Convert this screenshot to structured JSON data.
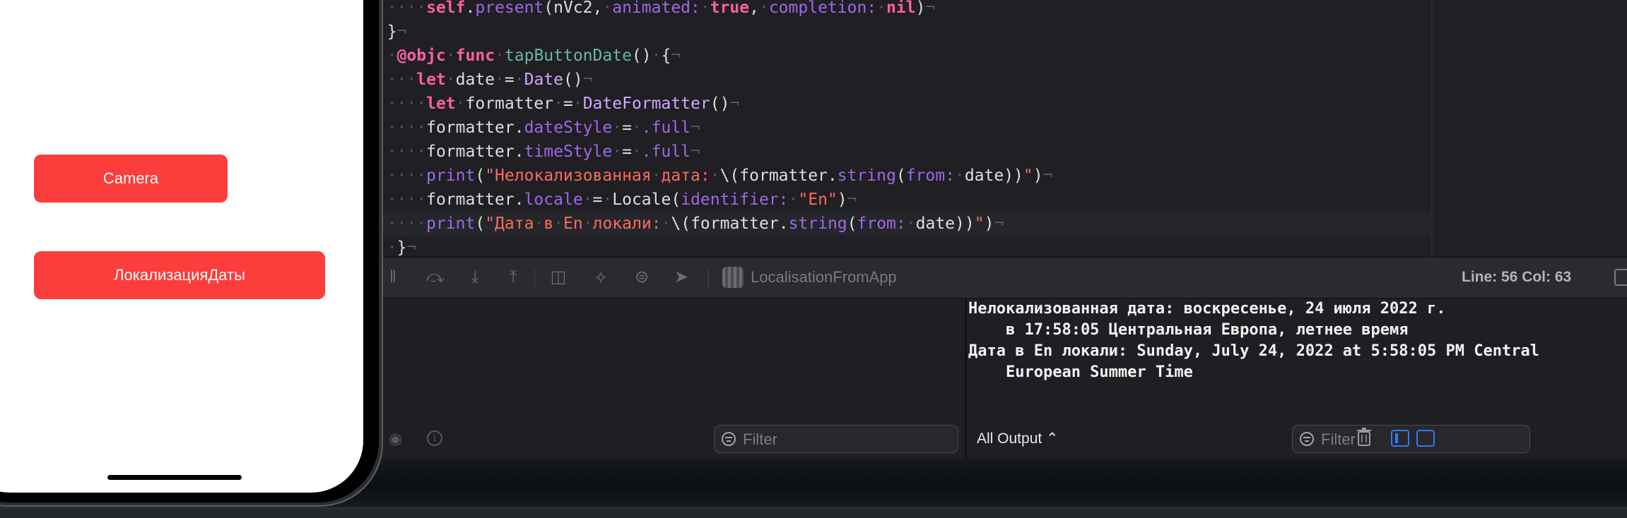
{
  "simulator": {
    "buttons": {
      "camera": "Camera",
      "date_localization": "ЛокализацияДаты"
    },
    "button_color": "#fb3d3b"
  },
  "editor": {
    "lines": [
      {
        "indent": "······",
        "tokens": [
          {
            "t": "self",
            "c": "kw"
          },
          {
            "t": ".",
            "c": ""
          },
          {
            "t": "present",
            "c": "mem"
          },
          {
            "t": "(nVc2,",
            "c": ""
          },
          {
            "t": "·",
            "c": "inv"
          },
          {
            "t": "animated:",
            "c": "ty"
          },
          {
            "t": "·",
            "c": "inv"
          },
          {
            "t": "true",
            "c": "kw"
          },
          {
            "t": ",",
            "c": ""
          },
          {
            "t": "·",
            "c": "inv"
          },
          {
            "t": "completion:",
            "c": "ty"
          },
          {
            "t": "·",
            "c": "inv"
          },
          {
            "t": "nil",
            "c": "kw"
          },
          {
            "t": ")",
            "c": ""
          },
          {
            "t": "¬",
            "c": "inv"
          }
        ]
      },
      {
        "indent": "··",
        "tokens": [
          {
            "t": "}",
            "c": ""
          },
          {
            "t": "¬",
            "c": "inv"
          }
        ]
      },
      {
        "indent": "···",
        "tokens": [
          {
            "t": "@objc",
            "c": "kw"
          },
          {
            "t": "·",
            "c": "inv"
          },
          {
            "t": "func",
            "c": "kw"
          },
          {
            "t": "·",
            "c": "inv"
          },
          {
            "t": "tapButtonDate",
            "c": "fn"
          },
          {
            "t": "()",
            "c": ""
          },
          {
            "t": "·",
            "c": "inv"
          },
          {
            "t": "{",
            "c": ""
          },
          {
            "t": "¬",
            "c": "inv"
          }
        ]
      },
      {
        "indent": "·····",
        "tokens": [
          {
            "t": "let",
            "c": "kw"
          },
          {
            "t": "·",
            "c": "inv"
          },
          {
            "t": "date",
            "c": ""
          },
          {
            "t": "·",
            "c": "inv"
          },
          {
            "t": "=",
            "c": ""
          },
          {
            "t": "·",
            "c": "inv"
          },
          {
            "t": "Date",
            "c": "ty2"
          },
          {
            "t": "()",
            "c": ""
          },
          {
            "t": "¬",
            "c": "inv"
          }
        ]
      },
      {
        "indent": "······",
        "tokens": [
          {
            "t": "let",
            "c": "kw"
          },
          {
            "t": "·",
            "c": "inv"
          },
          {
            "t": "formatter",
            "c": ""
          },
          {
            "t": "·",
            "c": "inv"
          },
          {
            "t": "=",
            "c": ""
          },
          {
            "t": "·",
            "c": "inv"
          },
          {
            "t": "DateFormatter",
            "c": "ty2"
          },
          {
            "t": "()",
            "c": ""
          },
          {
            "t": "¬",
            "c": "inv"
          }
        ]
      },
      {
        "indent": "······",
        "tokens": [
          {
            "t": "formatter.",
            "c": ""
          },
          {
            "t": "dateStyle",
            "c": "mem"
          },
          {
            "t": "·",
            "c": "inv"
          },
          {
            "t": "=",
            "c": ""
          },
          {
            "t": "·",
            "c": "inv"
          },
          {
            "t": ".full",
            "c": "mem"
          },
          {
            "t": "¬",
            "c": "inv"
          }
        ]
      },
      {
        "indent": "······",
        "tokens": [
          {
            "t": "formatter.",
            "c": ""
          },
          {
            "t": "timeStyle",
            "c": "mem"
          },
          {
            "t": "·",
            "c": "inv"
          },
          {
            "t": "=",
            "c": ""
          },
          {
            "t": "·",
            "c": "inv"
          },
          {
            "t": ".full",
            "c": "mem"
          },
          {
            "t": "¬",
            "c": "inv"
          }
        ]
      },
      {
        "indent": "······",
        "tokens": [
          {
            "t": "print",
            "c": "mem"
          },
          {
            "t": "(",
            "c": ""
          },
          {
            "t": "\"Нелокализованная",
            "c": "str"
          },
          {
            "t": "·",
            "c": "inv"
          },
          {
            "t": "дата:",
            "c": "str"
          },
          {
            "t": "·",
            "c": "inv"
          },
          {
            "t": "\\(formatter.",
            "c": ""
          },
          {
            "t": "string",
            "c": "mem"
          },
          {
            "t": "(",
            "c": ""
          },
          {
            "t": "from:",
            "c": "ty"
          },
          {
            "t": "·",
            "c": "inv"
          },
          {
            "t": "date))",
            "c": ""
          },
          {
            "t": "\"",
            "c": "str"
          },
          {
            "t": ")",
            "c": ""
          },
          {
            "t": "¬",
            "c": "inv"
          }
        ]
      },
      {
        "indent": "······",
        "tokens": [
          {
            "t": "formatter.",
            "c": ""
          },
          {
            "t": "locale",
            "c": "mem"
          },
          {
            "t": "·",
            "c": "inv"
          },
          {
            "t": "=",
            "c": ""
          },
          {
            "t": "·",
            "c": "inv"
          },
          {
            "t": "Locale",
            "c": ""
          },
          {
            "t": "(",
            "c": ""
          },
          {
            "t": "identifier:",
            "c": "ty"
          },
          {
            "t": "·",
            "c": "inv"
          },
          {
            "t": "\"En\"",
            "c": "str"
          },
          {
            "t": ")",
            "c": ""
          },
          {
            "t": "¬",
            "c": "inv"
          }
        ]
      },
      {
        "indent": "······",
        "current": true,
        "tokens": [
          {
            "t": "print",
            "c": "mem"
          },
          {
            "t": "(",
            "c": ""
          },
          {
            "t": "\"Дата",
            "c": "str"
          },
          {
            "t": "·",
            "c": "inv"
          },
          {
            "t": "в",
            "c": "str"
          },
          {
            "t": "·",
            "c": "inv"
          },
          {
            "t": "En",
            "c": "str"
          },
          {
            "t": "·",
            "c": "inv"
          },
          {
            "t": "локали:",
            "c": "str"
          },
          {
            "t": "·",
            "c": "inv"
          },
          {
            "t": "\\(formatter.",
            "c": ""
          },
          {
            "t": "string",
            "c": "mem"
          },
          {
            "t": "(",
            "c": ""
          },
          {
            "t": "from:",
            "c": "ty"
          },
          {
            "t": "·",
            "c": "inv"
          },
          {
            "t": "date))",
            "c": ""
          },
          {
            "t": "\"",
            "c": "str"
          },
          {
            "t": ")",
            "c": ""
          },
          {
            "t": "¬",
            "c": "inv"
          }
        ]
      },
      {
        "indent": "···",
        "tokens": [
          {
            "t": "}",
            "c": ""
          },
          {
            "t": "¬",
            "c": "inv"
          }
        ]
      }
    ]
  },
  "debug_bar": {
    "scheme": "LocalisationFromApp",
    "line_info": "Line: 56  Col: 63"
  },
  "console": {
    "output": "Нелокализованная дата: воскресенье, 24 июля 2022 г.\n    в 17:58:05 Центральная Европа, летнее время\nДата в En локали: Sunday, July 24, 2022 at 5:58:05 PM Central\n    European Summer Time",
    "all_output": "All Output ⌃",
    "filter_placeholder": "Filter"
  },
  "variables": {
    "filter_placeholder": "Filter"
  }
}
